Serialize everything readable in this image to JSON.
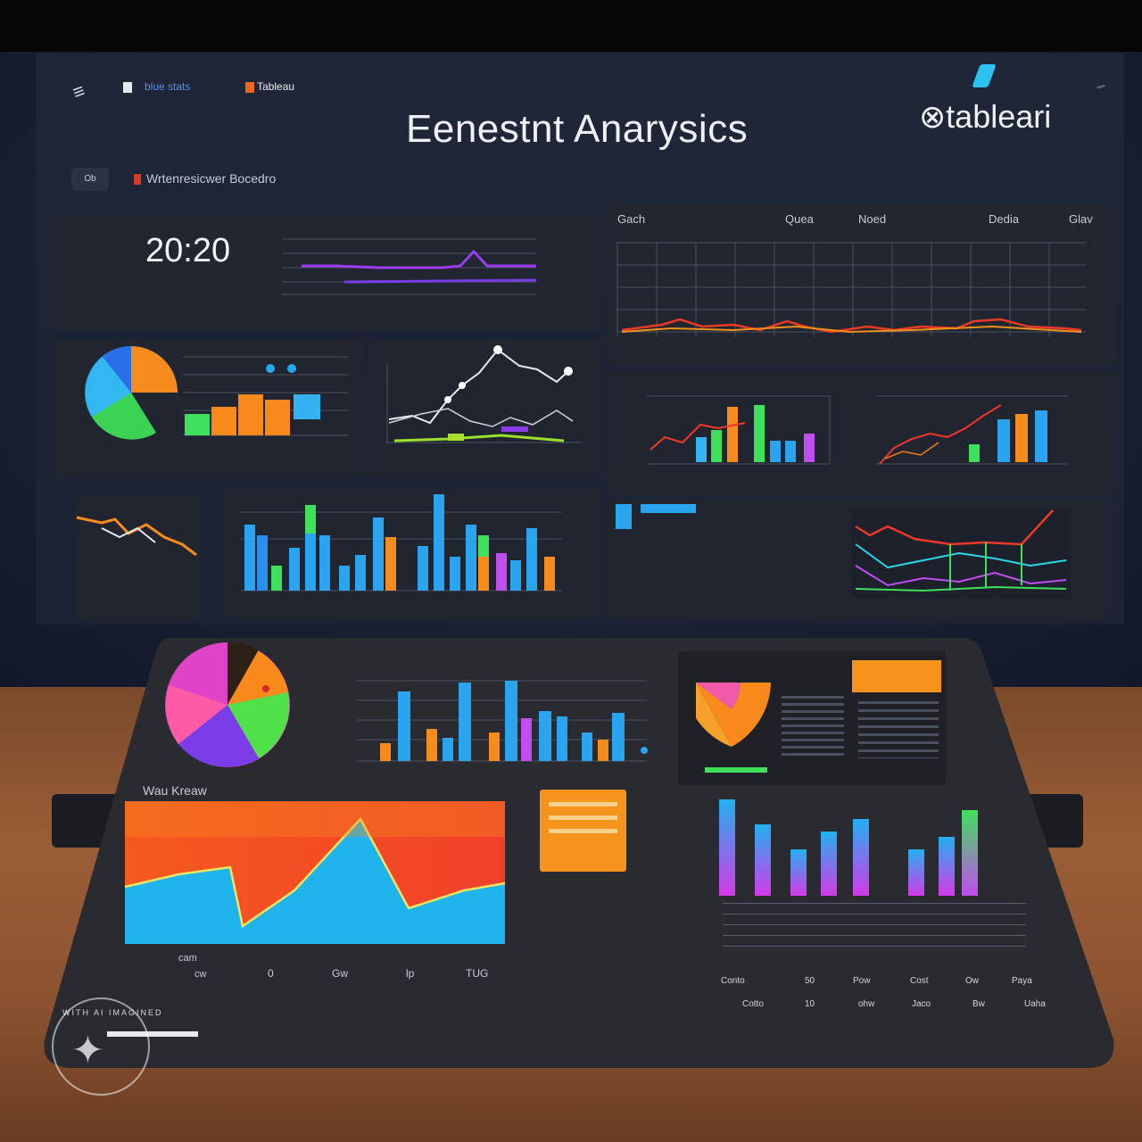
{
  "header": {
    "title": "Eenestnt Anarysics",
    "brand": "tableari",
    "nav_item_1": "blue stats",
    "nav_item_2": "Tableau",
    "toolbar_chip": "Ob",
    "toolbar_label": "Wrtenresicwer Bocedro"
  },
  "kpi": {
    "time": "20:20"
  },
  "top_right_chart": {
    "tabs": [
      "Gach",
      "Quea",
      "Noed",
      "Dedia",
      "Glav"
    ]
  },
  "tablet": {
    "area_chart_title": "Wau Kreaw",
    "area_x_labels": [
      "cam",
      "cw",
      "0",
      "Gw",
      "lp",
      "TUG"
    ],
    "bar_table_labels": [
      "Conto",
      "50",
      "Pow",
      "Cost",
      "Ow",
      "Paya"
    ],
    "bar_table_labels_2": [
      "Cotto",
      "10",
      "ohw",
      "Jaco",
      "Bw",
      "Uaha"
    ]
  },
  "watermark": {
    "text": "WITH AI IMAGINED"
  },
  "colors": {
    "background_wall": "#1a2236",
    "panel": "#222630",
    "tablet": "#2a2b30",
    "floor": "#8a5230",
    "accent_blue": "#2aa8e8",
    "accent_orange": "#f98a1c",
    "accent_green": "#4fe04a",
    "accent_purple": "#b24cf2",
    "accent_red": "#f0402a"
  },
  "icons": [
    "menu-icon",
    "brand-logo-icon",
    "settings-icon"
  ]
}
